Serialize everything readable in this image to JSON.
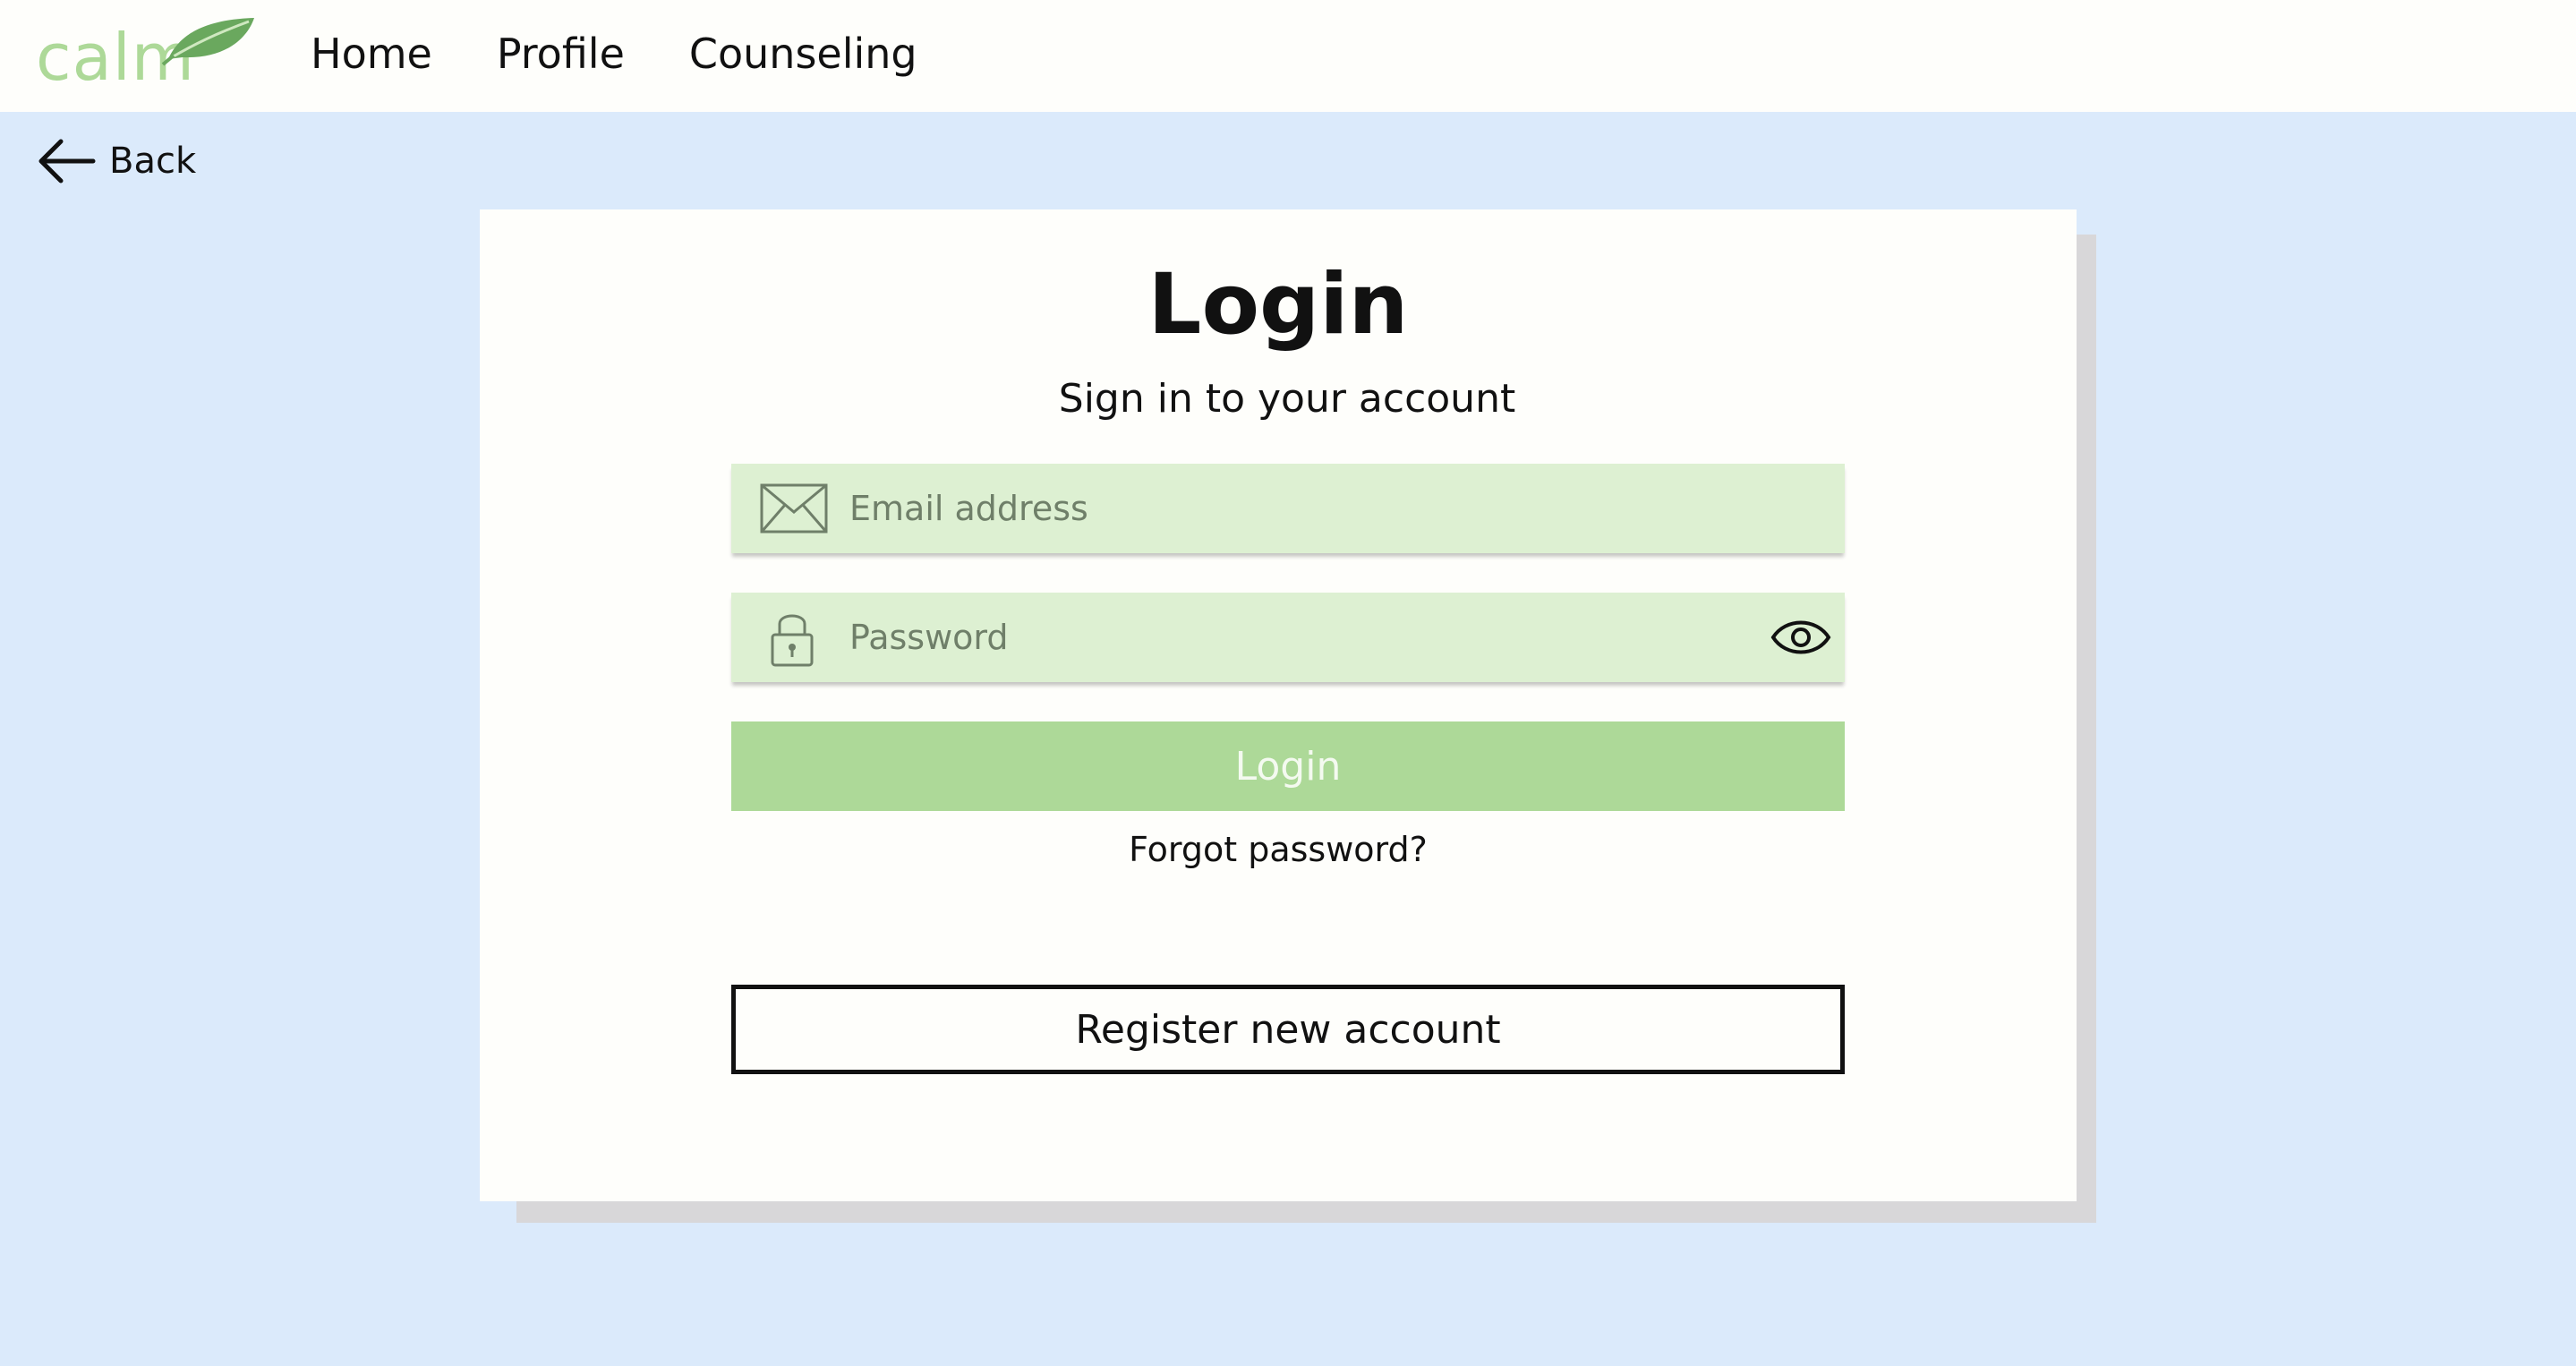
{
  "header": {
    "logo_text": "calm",
    "nav": [
      {
        "label": "Home"
      },
      {
        "label": "Profile"
      },
      {
        "label": "Counseling"
      }
    ]
  },
  "back": {
    "label": "Back",
    "icon": "arrow-left-icon"
  },
  "login": {
    "title": "Login",
    "subtitle": "Sign in to your account",
    "email": {
      "placeholder": "Email address",
      "value": "",
      "icon": "envelope-icon"
    },
    "password": {
      "placeholder": "Password",
      "value": "",
      "icon": "lock-icon",
      "toggle_icon": "eye-icon"
    },
    "submit_label": "Login",
    "forgot_label": "Forgot password?",
    "register_label": "Register new account"
  },
  "colors": {
    "background": "#dbeafb",
    "header": "#fefefb",
    "accent": "#add998",
    "field": "#ddf0d2",
    "leaf": "#6aa85e"
  }
}
